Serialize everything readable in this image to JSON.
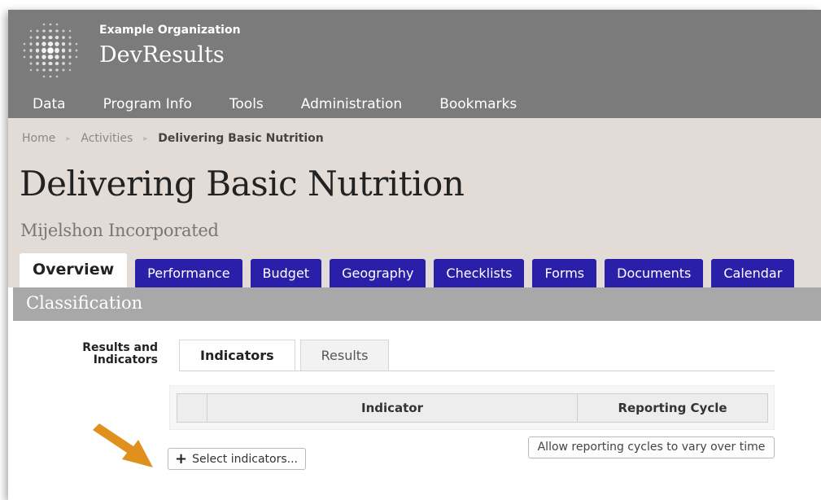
{
  "header": {
    "org_name": "Example Organization",
    "app_name": "DevResults"
  },
  "nav": [
    "Data",
    "Program Info",
    "Tools",
    "Administration",
    "Bookmarks"
  ],
  "breadcrumb": {
    "items": [
      "Home",
      "Activities"
    ],
    "current": "Delivering Basic Nutrition"
  },
  "page": {
    "title": "Delivering Basic Nutrition",
    "subtitle": "Mijelshon Incorporated"
  },
  "tabs": [
    {
      "label": "Overview",
      "active": true
    },
    {
      "label": "Performance",
      "active": false
    },
    {
      "label": "Budget",
      "active": false
    },
    {
      "label": "Geography",
      "active": false
    },
    {
      "label": "Checklists",
      "active": false
    },
    {
      "label": "Forms",
      "active": false
    },
    {
      "label": "Documents",
      "active": false
    },
    {
      "label": "Calendar",
      "active": false
    }
  ],
  "section": {
    "title": "Classification",
    "field_label": "Results and Indicators",
    "subtabs": [
      {
        "label": "Indicators",
        "active": true
      },
      {
        "label": "Results",
        "active": false
      }
    ],
    "table_headers": [
      "",
      "Indicator",
      "Reporting Cycle"
    ],
    "select_button": "Select indicators...",
    "vary_button": "Allow reporting cycles to vary over time"
  },
  "colors": {
    "header_bg": "#7b7b7b",
    "page_head_bg": "#e3dcd6",
    "tab_bg": "#2a1fa8",
    "section_bar_bg": "#a8a8a8",
    "arrow": "#e0901f"
  },
  "icons": {
    "logo": "globe-dots-icon",
    "plus": "plus-icon",
    "breadcrumb_separator": "triangle-right-icon",
    "annotation": "arrow-icon"
  }
}
